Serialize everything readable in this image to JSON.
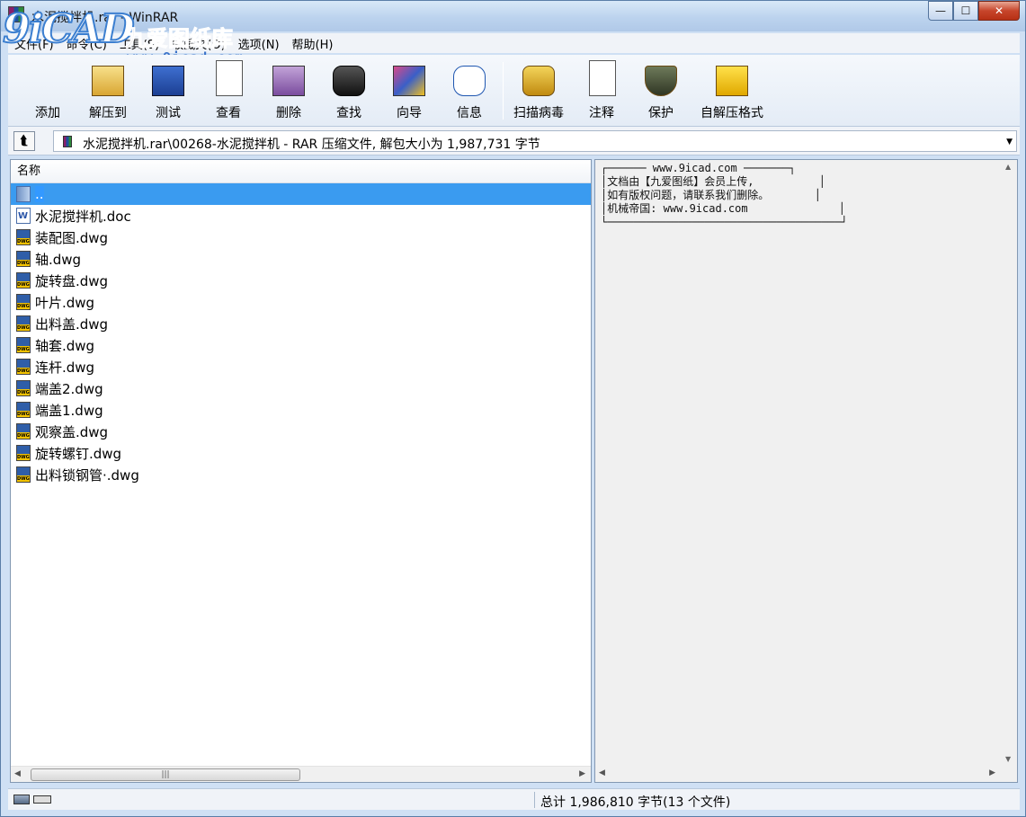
{
  "window": {
    "title": "水泥搅拌机.rar - WinRAR",
    "controls": {
      "minimize": "—",
      "maximize": "☐",
      "close": "✕"
    }
  },
  "watermark": {
    "logo": "9iCAD",
    "name": "九爱图纸库",
    "url": "www.9icad.com"
  },
  "menu": {
    "items": [
      "文件(F)",
      "命令(C)",
      "工具(S)",
      "收藏夹(O)",
      "选项(N)",
      "帮助(H)"
    ]
  },
  "toolbar": {
    "buttons": [
      {
        "label": "添加",
        "icon": "add-books-icon"
      },
      {
        "label": "解压到",
        "icon": "extract-folder-icon"
      },
      {
        "label": "测试",
        "icon": "test-check-icon"
      },
      {
        "label": "查看",
        "icon": "view-glasses-icon"
      },
      {
        "label": "删除",
        "icon": "delete-recycle-icon"
      },
      {
        "label": "查找",
        "icon": "find-binoculars-icon"
      },
      {
        "label": "向导",
        "icon": "wizard-icon"
      },
      {
        "label": "信息",
        "icon": "info-icon"
      },
      {
        "label": "扫描病毒",
        "icon": "virus-scan-icon"
      },
      {
        "label": "注释",
        "icon": "comment-icon"
      },
      {
        "label": "保护",
        "icon": "protect-shield-icon"
      },
      {
        "label": "自解压格式",
        "icon": "sfx-icon"
      }
    ]
  },
  "address": {
    "path": "水泥搅拌机.rar\\00268-水泥搅拌机 - RAR 压缩文件, 解包大小为 1,987,731 字节",
    "up_glyph": "⮬",
    "dropdown_glyph": "▼"
  },
  "filelist": {
    "column_header": "名称",
    "rows": [
      {
        "name": "..",
        "type": "folder",
        "selected": true
      },
      {
        "name": "水泥搅拌机.doc",
        "type": "doc"
      },
      {
        "name": "装配图.dwg",
        "type": "dwg"
      },
      {
        "name": "轴.dwg",
        "type": "dwg"
      },
      {
        "name": "旋转盘.dwg",
        "type": "dwg"
      },
      {
        "name": "叶片.dwg",
        "type": "dwg"
      },
      {
        "name": "出料盖.dwg",
        "type": "dwg"
      },
      {
        "name": "轴套.dwg",
        "type": "dwg"
      },
      {
        "name": "连杆.dwg",
        "type": "dwg"
      },
      {
        "name": "端盖2.dwg",
        "type": "dwg"
      },
      {
        "name": "端盖1.dwg",
        "type": "dwg"
      },
      {
        "name": "观察盖.dwg",
        "type": "dwg"
      },
      {
        "name": "旋转螺钉.dwg",
        "type": "dwg"
      },
      {
        "name": "出料锁钢管·.dwg",
        "type": "dwg"
      }
    ]
  },
  "comment": {
    "text": "┌────── www.9icad.com ───────┐\n│文档由【九爱图纸】会员上传,          │\n│如有版权问题，请联系我们删除。       │\n│机械帝国: www.9icad.com              │\n└────────────────────────────────────┘"
  },
  "status": {
    "summary": "总计 1,986,810 字节(13 个文件)"
  },
  "colors": {
    "selection": "#3399ff",
    "frame": "#cfe0f4"
  }
}
